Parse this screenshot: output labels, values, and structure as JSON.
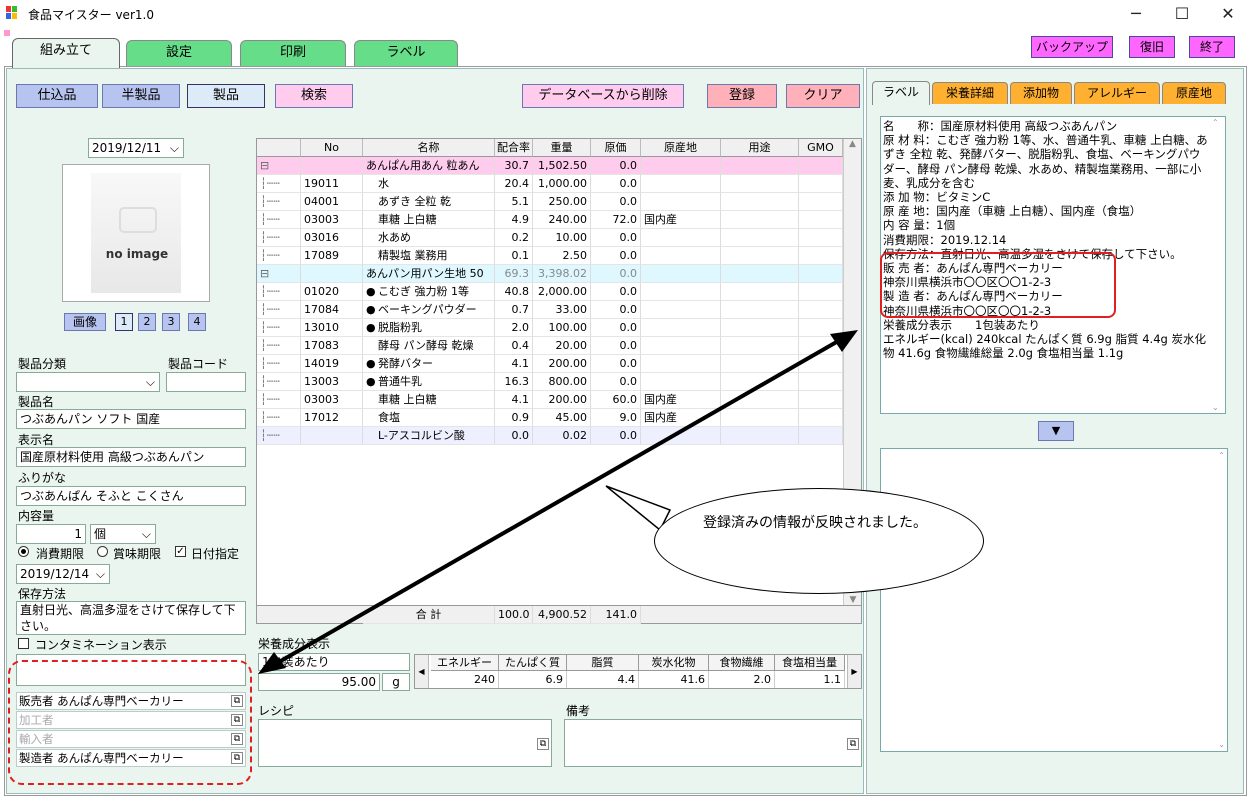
{
  "window": {
    "title": "食品マイスター ver1.0",
    "min": "─",
    "max": "☐",
    "close": "✕"
  },
  "main_tabs": [
    "組み立て",
    "設定",
    "印刷",
    "ラベル"
  ],
  "top_buttons": [
    "バックアップ",
    "復旧",
    "終了"
  ],
  "toolbar": {
    "shikomi": "仕込品",
    "hanseihin": "半製品",
    "seihin": "製品",
    "search": "検索",
    "delete_db": "データベースから削除",
    "register": "登録",
    "clear": "クリア"
  },
  "date": "2019/12/11",
  "no_image": "no image",
  "image_btn": "画像",
  "image_pages": [
    "1",
    "2",
    "3",
    "4"
  ],
  "form": {
    "category_label": "製品分類",
    "code_label": "製品コード",
    "name_label": "製品名",
    "name": "つぶあんパン ソフト 国産",
    "display_label": "表示名",
    "display": "国産原材料使用 高級つぶあんパン",
    "furigana_label": "ふりがな",
    "furigana": "つぶあんぱん そふと こくさん",
    "content_label": "内容量",
    "content_qty": "1",
    "content_unit": "個",
    "expiry1": "消費期限",
    "expiry2": "賞味期限",
    "date_spec": "日付指定",
    "expiry_date": "2019/12/14",
    "storage_label": "保存方法",
    "storage": "直射日光、高温多湿をさけて保存して下さい。",
    "contamination": "コンタミネーション表示"
  },
  "parties": [
    {
      "text": "販売者 あんぱん専門ベーカリー",
      "dim": false
    },
    {
      "text": "加工者",
      "dim": true
    },
    {
      "text": "輸入者",
      "dim": true
    },
    {
      "text": "製造者 あんぱん専門ベーカリー",
      "dim": false
    }
  ],
  "grid": {
    "headers": [
      "No",
      "名称",
      "配合率",
      "重量",
      "原価",
      "原産地",
      "用途",
      "GMO"
    ],
    "rows": [
      {
        "type": "group1",
        "no": "",
        "name": "あんぱん用あん 粒あん",
        "rate": "30.7",
        "weight": "1,502.50",
        "cost": "0.0",
        "origin": ""
      },
      {
        "type": "item",
        "no": "19011",
        "dot": "",
        "name": "水",
        "rate": "20.4",
        "weight": "1,000.00",
        "cost": "0.0",
        "origin": ""
      },
      {
        "type": "item",
        "no": "04001",
        "dot": "",
        "name": "あずき 全粒 乾",
        "rate": "5.1",
        "weight": "250.00",
        "cost": "0.0",
        "origin": ""
      },
      {
        "type": "item",
        "no": "03003",
        "dot": "",
        "name": "車糖 上白糖",
        "rate": "4.9",
        "weight": "240.00",
        "cost": "72.0",
        "origin": "国内産"
      },
      {
        "type": "item",
        "no": "03016",
        "dot": "",
        "name": "水あめ",
        "rate": "0.2",
        "weight": "10.00",
        "cost": "0.0",
        "origin": ""
      },
      {
        "type": "item",
        "no": "17089",
        "dot": "",
        "name": "精製塩 業務用",
        "rate": "0.1",
        "weight": "2.50",
        "cost": "0.0",
        "origin": ""
      },
      {
        "type": "group2",
        "no": "",
        "name": "あんパン用パン生地 50",
        "rate": "69.3",
        "weight": "3,398.02",
        "cost": "0.0",
        "origin": ""
      },
      {
        "type": "item",
        "no": "01020",
        "dot": "●",
        "name": "こむぎ 強力粉 1等",
        "rate": "40.8",
        "weight": "2,000.00",
        "cost": "0.0",
        "origin": ""
      },
      {
        "type": "item",
        "no": "17084",
        "dot": "●",
        "name": "ベーキングパウダー",
        "rate": "0.7",
        "weight": "33.00",
        "cost": "0.0",
        "origin": ""
      },
      {
        "type": "item",
        "no": "13010",
        "dot": "●",
        "name": "脱脂粉乳",
        "rate": "2.0",
        "weight": "100.00",
        "cost": "0.0",
        "origin": ""
      },
      {
        "type": "item",
        "no": "17083",
        "dot": "",
        "name": "酵母 パン酵母 乾燥",
        "rate": "0.4",
        "weight": "20.00",
        "cost": "0.0",
        "origin": ""
      },
      {
        "type": "item",
        "no": "14019",
        "dot": "●",
        "name": "発酵バター",
        "rate": "4.1",
        "weight": "200.00",
        "cost": "0.0",
        "origin": ""
      },
      {
        "type": "item",
        "no": "13003",
        "dot": "●",
        "name": "普通牛乳",
        "rate": "16.3",
        "weight": "800.00",
        "cost": "0.0",
        "origin": ""
      },
      {
        "type": "item",
        "no": "03003",
        "dot": "",
        "name": "車糖 上白糖",
        "rate": "4.1",
        "weight": "200.00",
        "cost": "60.0",
        "origin": "国内産"
      },
      {
        "type": "item",
        "no": "17012",
        "dot": "",
        "name": "食塩",
        "rate": "0.9",
        "weight": "45.00",
        "cost": "9.0",
        "origin": "国内産"
      },
      {
        "type": "last",
        "no": "",
        "dot": "",
        "name": "L-アスコルビン酸",
        "rate": "0.0",
        "weight": "0.02",
        "cost": "0.0",
        "origin": ""
      }
    ],
    "total_label": "合 計",
    "total_rate": "100.0",
    "total_weight": "4,900.52",
    "total_cost": "141.0"
  },
  "nutrition": {
    "label": "栄養成分表示",
    "basis": "1包装あたり",
    "amount": "95.00",
    "unit": "g",
    "headers": [
      "エネルギー",
      "たんぱく質",
      "脂質",
      "炭水化物",
      "食物繊維",
      "食塩相当量"
    ],
    "values": [
      "240",
      "6.9",
      "4.4",
      "41.6",
      "2.0",
      "1.1"
    ]
  },
  "recipe_label": "レシピ",
  "notes_label": "備考",
  "right_tabs": [
    "ラベル",
    "栄養詳細",
    "添加物",
    "アレルギー",
    "原産地"
  ],
  "label_text": "名　　称：国産原材料使用 高級つぶあんパン\n原 材 料：こむぎ 強力粉 1等、水、普通牛乳、車糖 上白糖、あずき 全粒 乾、発酵バター、脱脂粉乳、食塩、ベーキングパウダー、酵母 パン酵母 乾燥、水あめ、精製塩業務用、一部に小麦、乳成分を含む\n添 加 物：ビタミンC\n原 産 地：国内産（車糖 上白糖）、国内産（食塩）\n内 容 量：1個\n消費期限：2019.12.14\n保存方法：直射日光、高温多湿をさけて保存して下さい。\n販 売 者：あんぱん専門ベーカリー\n神奈川県横浜市〇〇区〇〇1-2-3\n製 造 者：あんぱん専門ベーカリー\n神奈川県横浜市〇〇区〇〇1-2-3\n栄養成分表示　　1包装あたり\nエネルギー(kcal) 240kcal たんぱく質 6.9g 脂質 4.4g 炭水化物 41.6g 食物繊維総量 2.0g 食塩相当量 1.1g",
  "callout": "登録済みの情報が反映されました。",
  "colors": {
    "pink": "#ffccee",
    "cyan": "#dff8ff",
    "green": "#66dd88",
    "highlight": "#e02020"
  }
}
